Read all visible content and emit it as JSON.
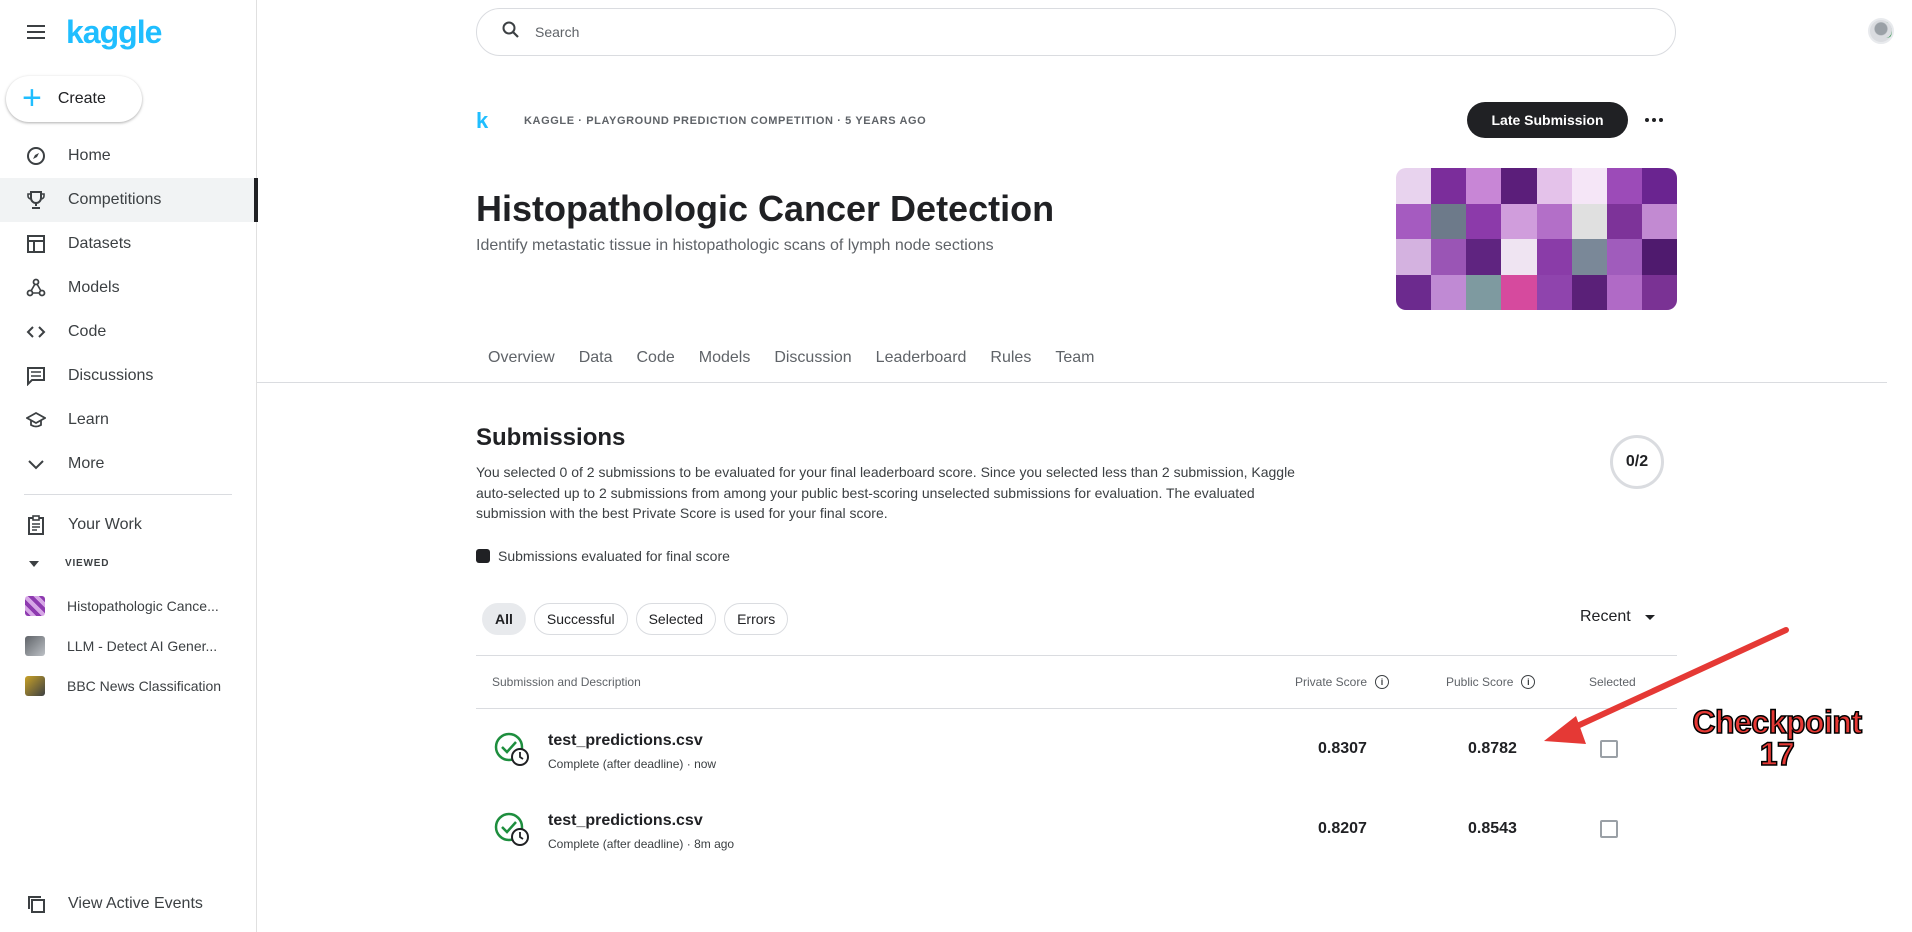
{
  "brand": {
    "logo": "kaggle"
  },
  "sidebar": {
    "create_label": "Create",
    "items": [
      {
        "label": "Home",
        "icon": "compass-icon"
      },
      {
        "label": "Competitions",
        "icon": "trophy-icon",
        "active": true
      },
      {
        "label": "Datasets",
        "icon": "table-icon"
      },
      {
        "label": "Models",
        "icon": "models-icon"
      },
      {
        "label": "Code",
        "icon": "code-icon"
      },
      {
        "label": "Discussions",
        "icon": "discussion-icon"
      },
      {
        "label": "Learn",
        "icon": "school-icon"
      },
      {
        "label": "More",
        "icon": "chevron-down-icon"
      }
    ],
    "your_work": "Your Work",
    "viewed_label": "VIEWED",
    "viewed": [
      {
        "label": "Histopathologic Cance...",
        "color": "#8e3ab0"
      },
      {
        "label": "LLM - Detect AI Gener...",
        "color": "#5f6368"
      },
      {
        "label": "BBC News Classification",
        "color": "#c9a227"
      }
    ],
    "view_active_events": "View Active Events"
  },
  "search": {
    "placeholder": "Search"
  },
  "competition": {
    "meta": "KAGGLE · PLAYGROUND PREDICTION COMPETITION · 5 YEARS AGO",
    "logo_letter": "k",
    "late_submission": "Late Submission",
    "title": "Histopathologic Cancer Detection",
    "subtitle": "Identify metastatic tissue in histopathologic scans of lymph node sections",
    "tabs": [
      "Overview",
      "Data",
      "Code",
      "Models",
      "Discussion",
      "Leaderboard",
      "Rules",
      "Team"
    ]
  },
  "submissions": {
    "title": "Submissions",
    "description": "You selected 0 of 2 submissions to be evaluated for your final leaderboard score. Since you selected less than 2 submission, Kaggle auto-selected up to 2 submissions from among your public best-scoring unselected submissions for evaluation. The evaluated submission with the best Private Score is used for your final score.",
    "counter": "0/2",
    "legend": "Submissions evaluated for final score",
    "filters": [
      "All",
      "Successful",
      "Selected",
      "Errors"
    ],
    "sort": "Recent",
    "columns": {
      "submission": "Submission and Description",
      "private": "Private Score",
      "public": "Public Score",
      "selected": "Selected"
    },
    "rows": [
      {
        "file": "test_predictions.csv",
        "status": "Complete (after deadline) · now",
        "private": "0.8307",
        "public": "0.8782",
        "selected": false
      },
      {
        "file": "test_predictions.csv",
        "status": "Complete (after deadline) · 8m ago",
        "private": "0.8207",
        "public": "0.8543",
        "selected": false
      }
    ]
  },
  "annotation": {
    "text": "Checkpoint 17",
    "line1": "Checkpoint",
    "line2": "17",
    "color": "#e53935"
  }
}
